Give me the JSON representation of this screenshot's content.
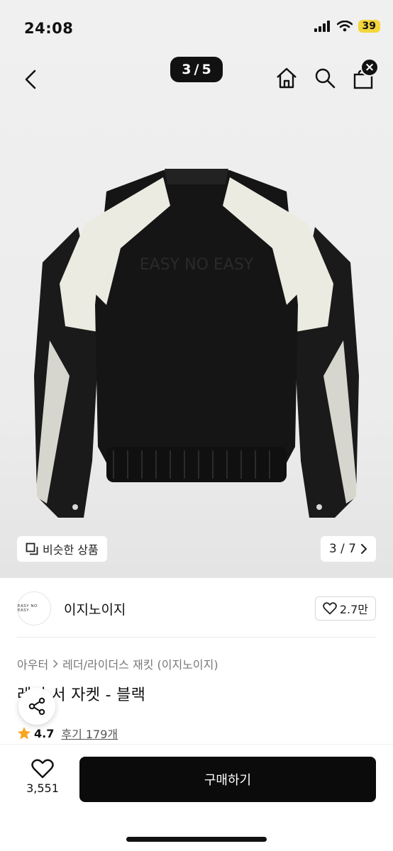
{
  "status_bar": {
    "time": "24:08",
    "battery": "39"
  },
  "nav": {
    "image_counter_current": "3",
    "image_counter_separator": "/",
    "image_counter_total": "5",
    "close_symbol": "×"
  },
  "image": {
    "logo_text": "EASY NO EASY",
    "similar_products_label": "비슷한 상품",
    "page_indicator": "3 / 7"
  },
  "brand": {
    "logo_text": "EASY NO EASY",
    "name": "이지노이지",
    "likes": "2.7만"
  },
  "breadcrumb": {
    "category": "아우터",
    "subcategory": "레더/라이더스 재킷 (이지노이지)"
  },
  "product": {
    "title": "레더 서 자켓 - 블랙"
  },
  "rating": {
    "value": "4.7",
    "reviews_label": "후기 179개"
  },
  "bottom_bar": {
    "wish_count": "3,551",
    "buy_label": "구매하기"
  },
  "colors": {
    "accent_star": "#f5a623",
    "buy_button": "#0b0b0b",
    "battery": "#f4d63a"
  }
}
